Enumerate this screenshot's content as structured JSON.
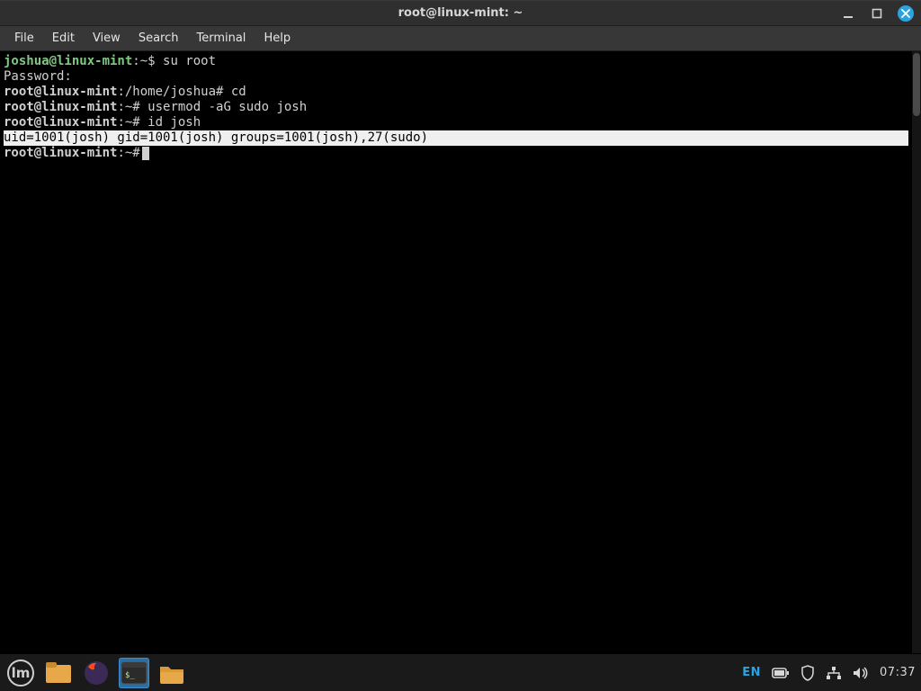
{
  "window": {
    "title": "root@linux-mint: ~"
  },
  "menu": {
    "items": [
      "File",
      "Edit",
      "View",
      "Search",
      "Terminal",
      "Help"
    ]
  },
  "terminal": {
    "lines": [
      {
        "kind": "prompt-user",
        "prompt": "joshua@linux-mint",
        "path": ":~$",
        "cmd": " su root"
      },
      {
        "kind": "plain",
        "text": "Password:"
      },
      {
        "kind": "prompt-root",
        "prompt": "root@linux-mint",
        "path": ":/home/joshua#",
        "cmd": " cd"
      },
      {
        "kind": "prompt-root",
        "prompt": "root@linux-mint",
        "path": ":~#",
        "cmd": " usermod -aG sudo josh"
      },
      {
        "kind": "prompt-root",
        "prompt": "root@linux-mint",
        "path": ":~#",
        "cmd": " id josh"
      },
      {
        "kind": "highlight",
        "text": "uid=1001(josh) gid=1001(josh) groups=1001(josh),27(sudo)"
      },
      {
        "kind": "prompt-root",
        "prompt": "root@linux-mint",
        "path": ":~#",
        "cmd": "",
        "cursor": true
      }
    ]
  },
  "panel": {
    "lang": "EN",
    "clock": "07:37",
    "icons": {
      "menu": "mint-menu-icon",
      "files": "files-icon",
      "firefox": "firefox-icon",
      "terminal": "terminal-icon",
      "folder": "folder-icon",
      "battery": "battery-icon",
      "shield": "shield-icon",
      "network": "network-icon",
      "volume": "volume-icon"
    }
  }
}
